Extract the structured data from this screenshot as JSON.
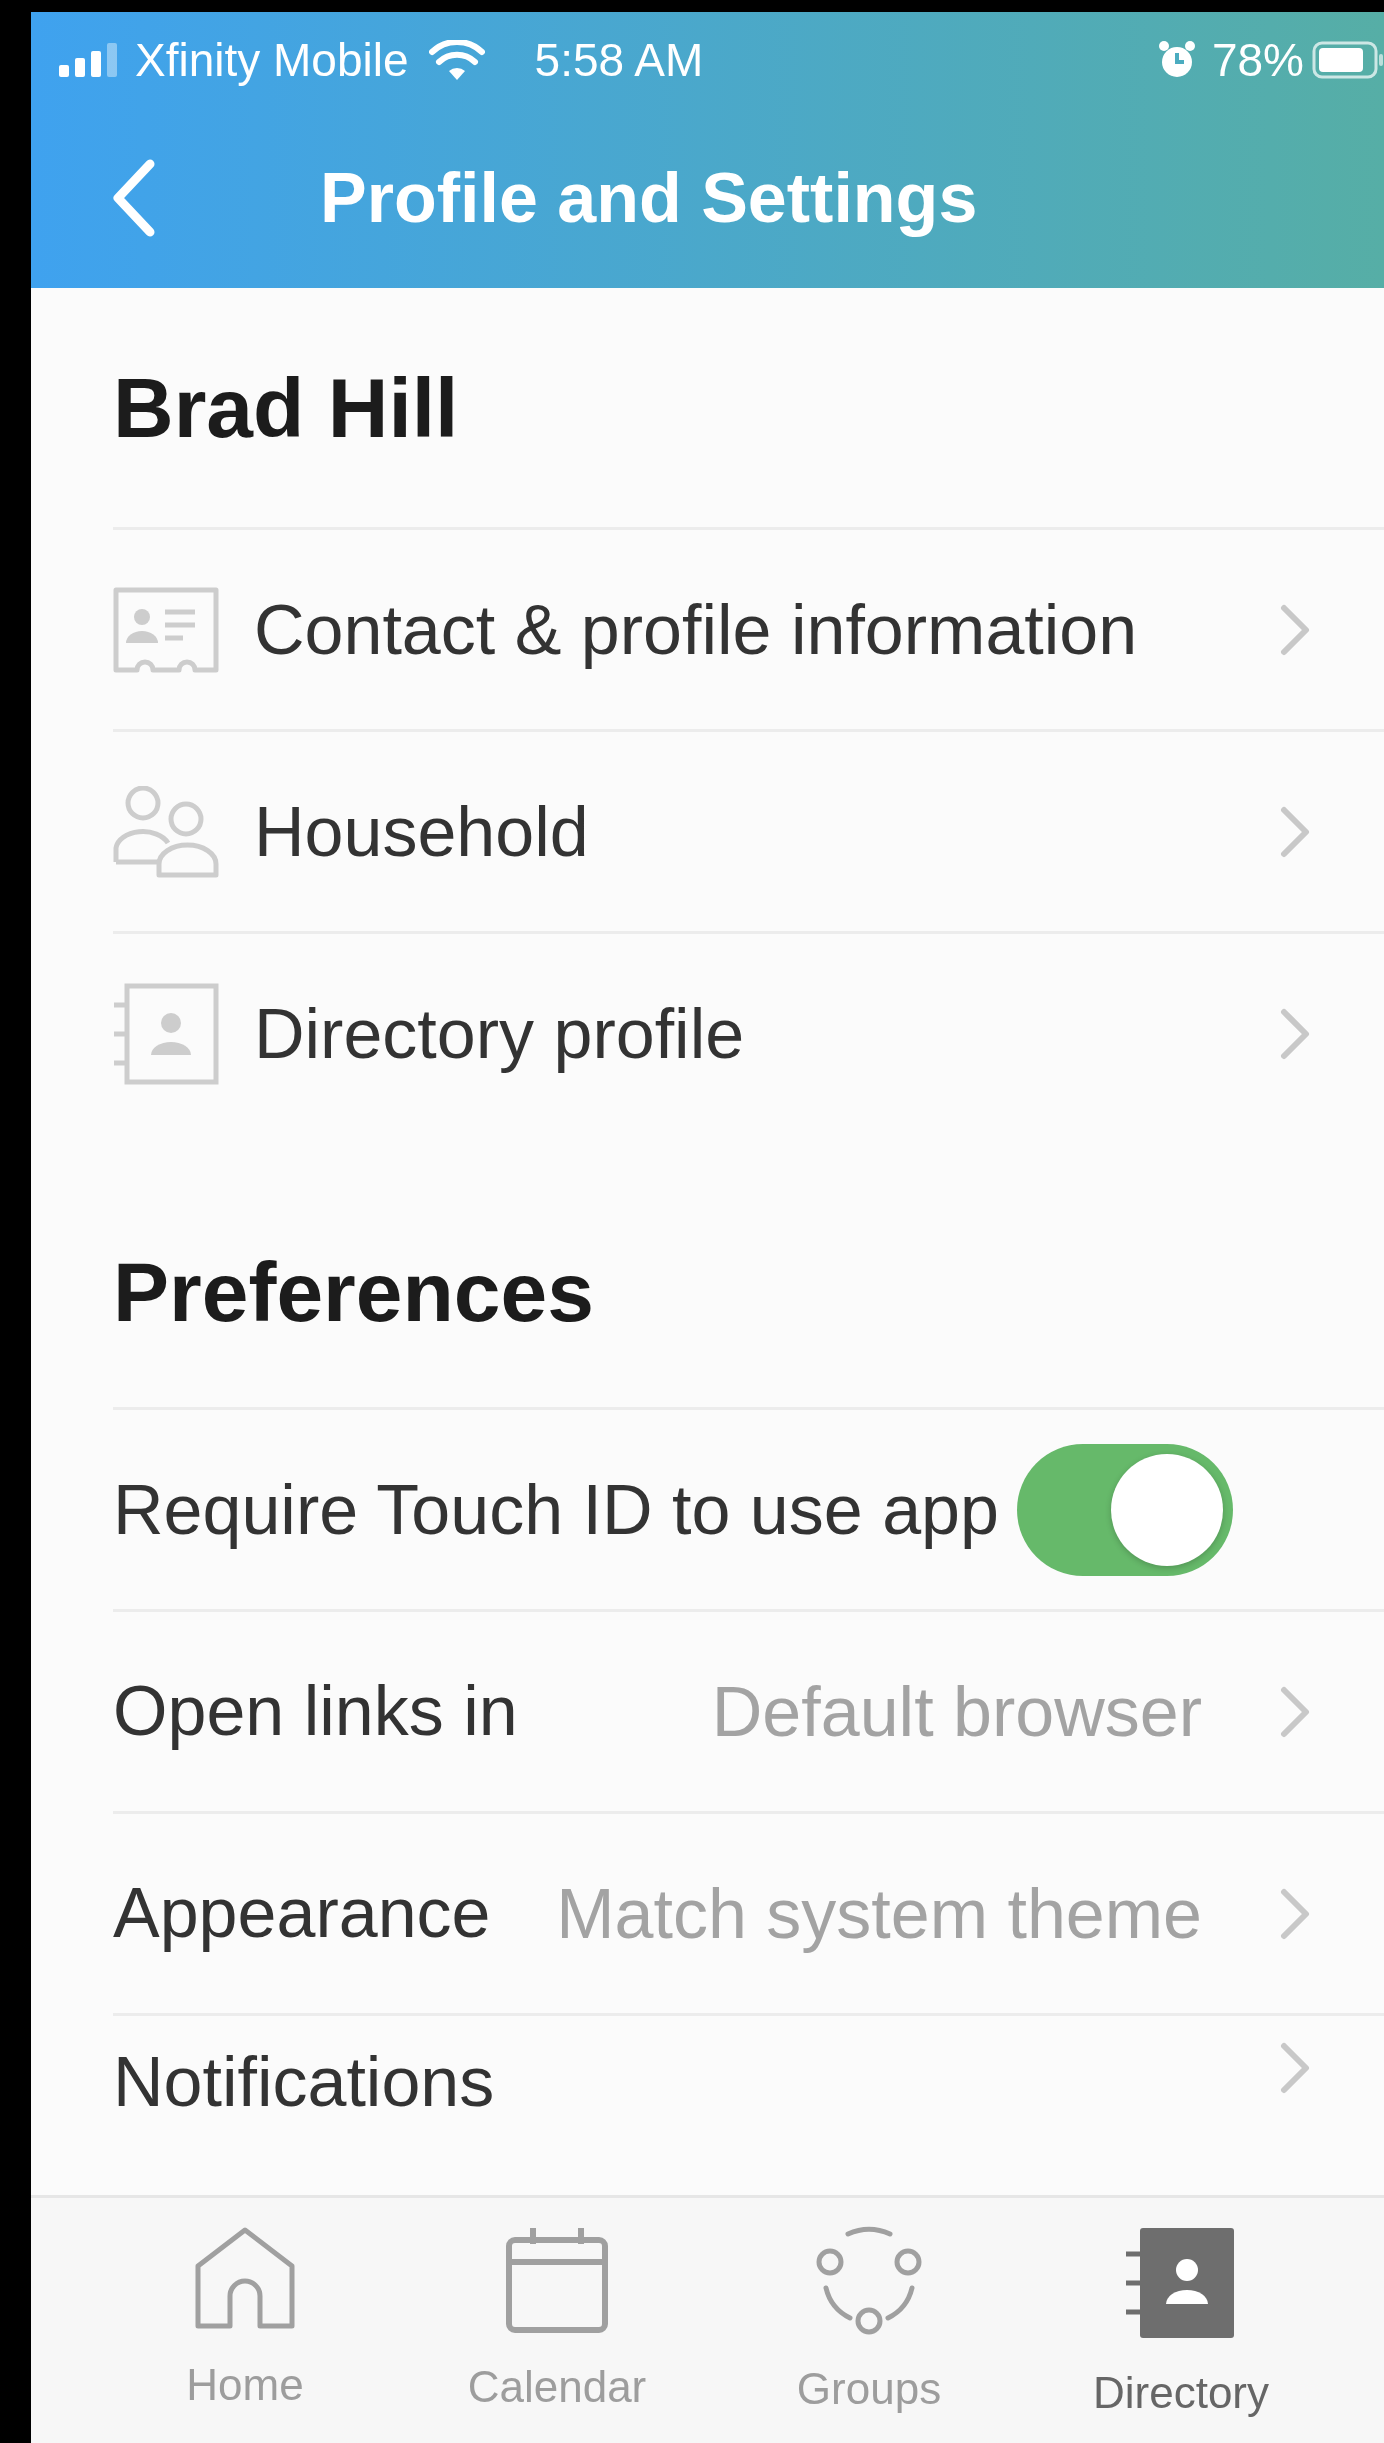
{
  "status_bar": {
    "carrier": "Xfinity Mobile",
    "time": "5:58 AM",
    "battery": "78%"
  },
  "header": {
    "title": "Profile and Settings"
  },
  "profile": {
    "name": "Brad Hill",
    "items": [
      {
        "label": "Contact & profile information"
      },
      {
        "label": "Household"
      },
      {
        "label": "Directory profile"
      }
    ]
  },
  "preferences": {
    "title": "Preferences",
    "items": [
      {
        "kind": "toggle",
        "label": "Require Touch ID to use app",
        "on": true
      },
      {
        "kind": "choice",
        "label": "Open links in",
        "value": "Default browser"
      },
      {
        "kind": "choice",
        "label": "Appearance",
        "value": "Match system theme"
      },
      {
        "kind": "link",
        "label": "Notifications"
      }
    ]
  },
  "tab_bar": [
    {
      "label": "Home",
      "selected": false
    },
    {
      "label": "Calendar",
      "selected": false
    },
    {
      "label": "Groups",
      "selected": false
    },
    {
      "label": "Directory",
      "selected": true
    }
  ]
}
